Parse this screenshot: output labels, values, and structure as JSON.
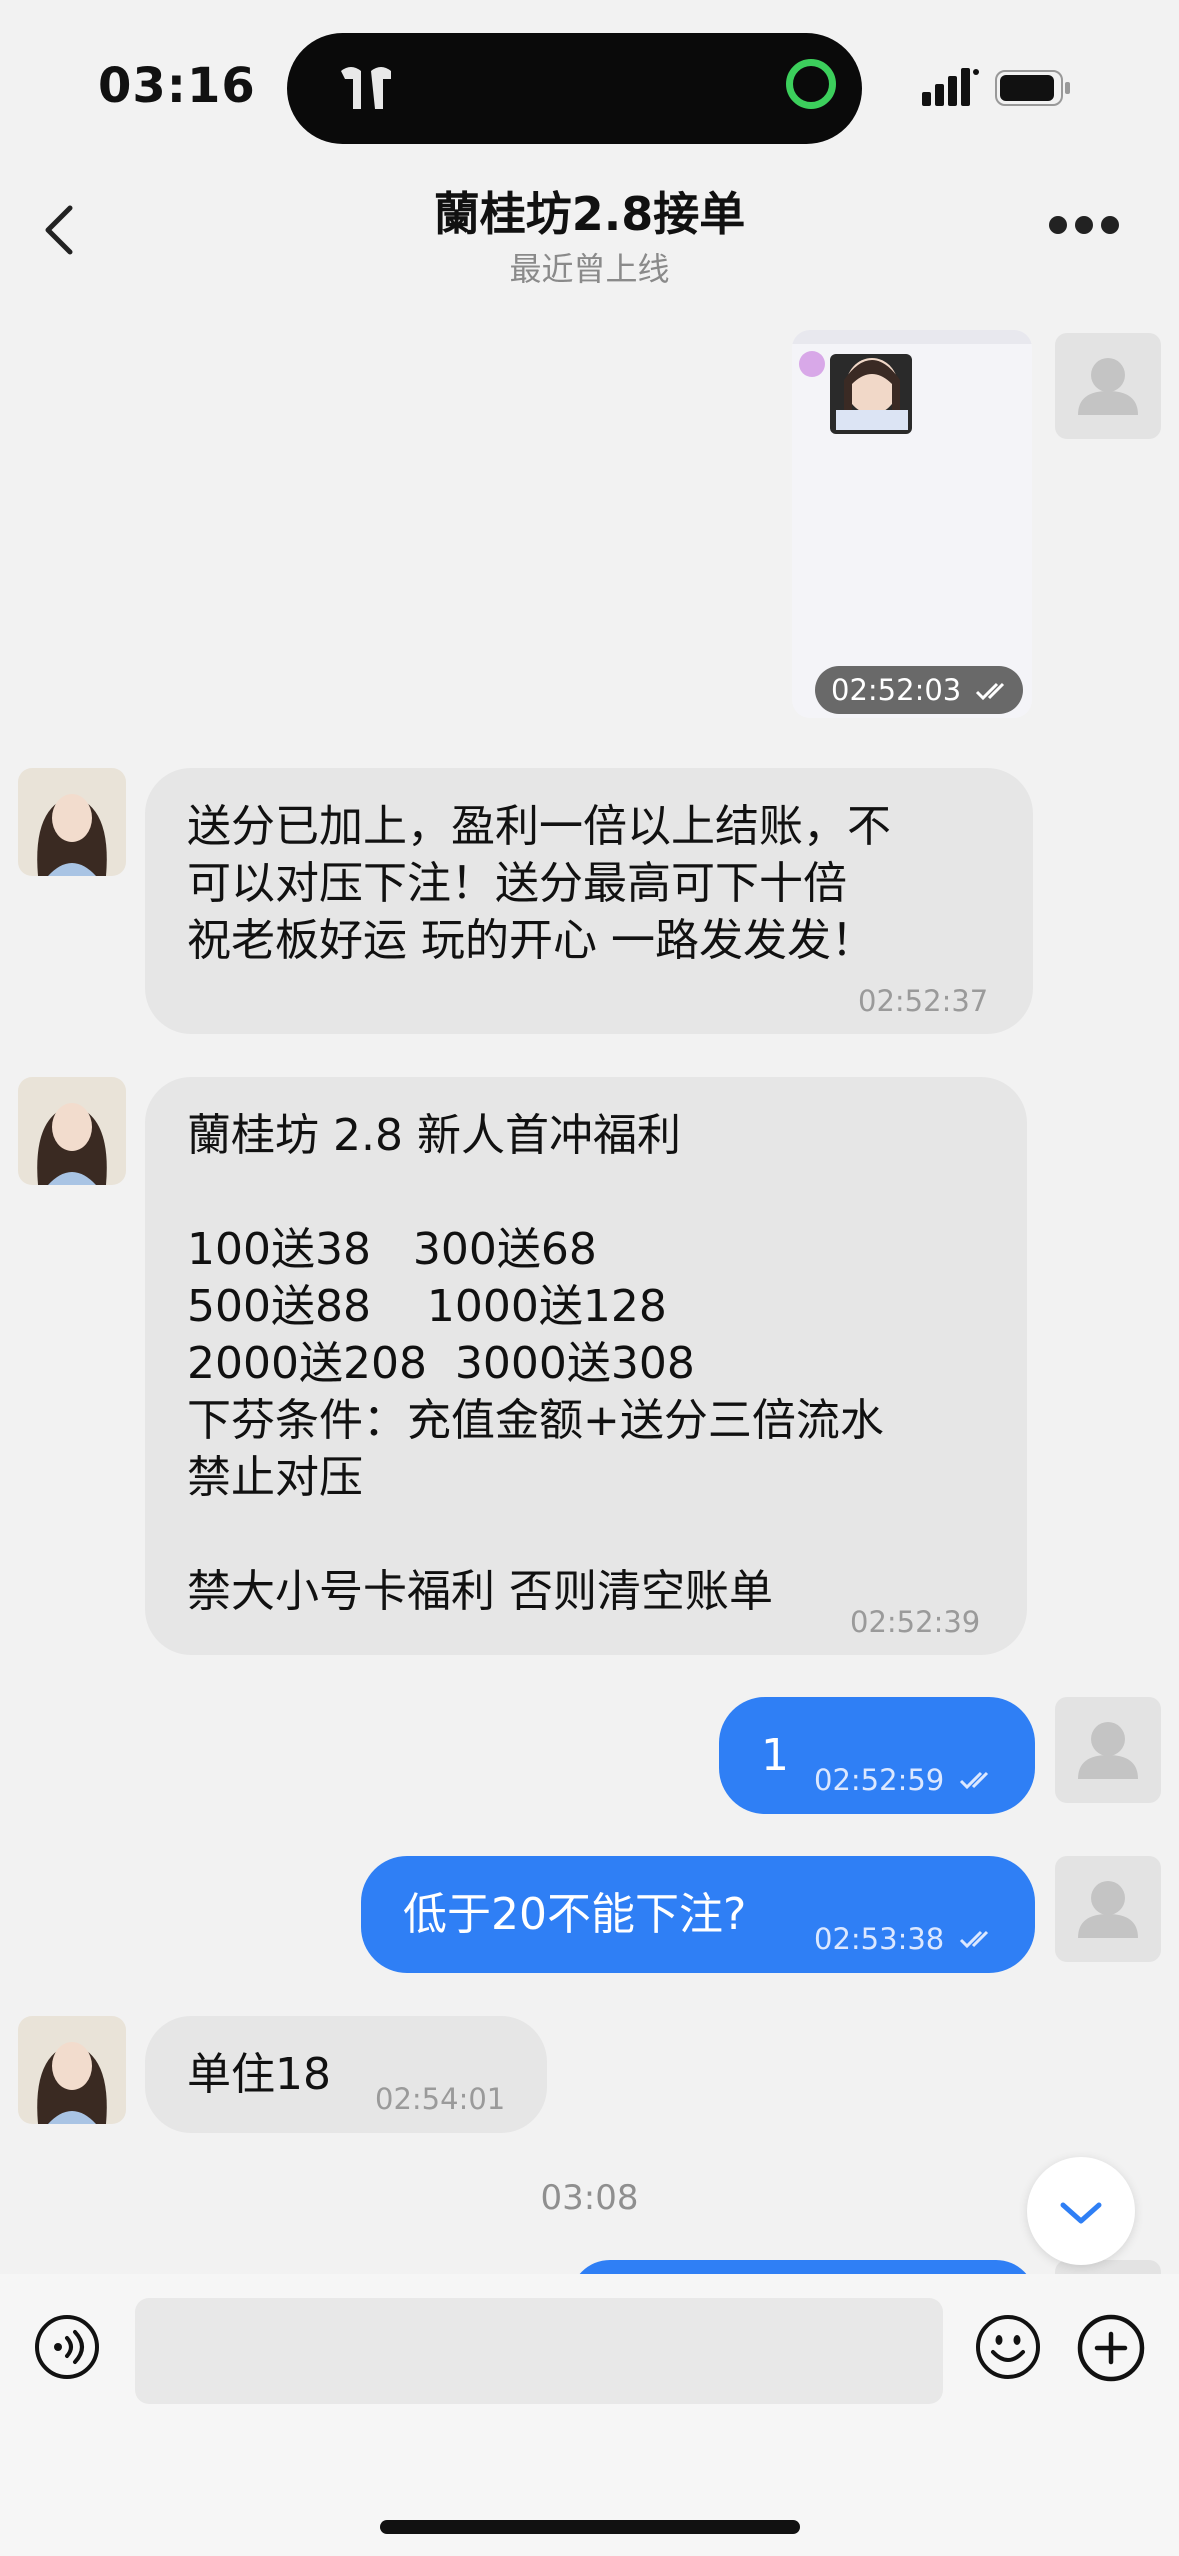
{
  "status": {
    "time": "03:16"
  },
  "header": {
    "title": "蘭桂坊2.8接单",
    "subtitle": "最近曾上线"
  },
  "messages": {
    "image_time": "02:52:03",
    "m1": {
      "text": "送分已加上，盈利一倍以上结账，不\n可以对压下注！送分最高可下十倍\n祝老板好运 玩的开心 一路发发发！",
      "time": "02:52:37"
    },
    "m2": {
      "text": "蘭桂坊 2.8 新人首冲福利\n\n100送38   300送68\n500送88    1000送128\n2000送208  3000送308\n下芬条件：充值金额+送分三倍流水\n禁止对压\n\n禁大小号卡福利 否则清空账单",
      "time": "02:52:39"
    },
    "m3": {
      "text": "1",
      "time": "02:52:59"
    },
    "m4": {
      "text": "低于20不能下注?",
      "time": "02:53:38"
    },
    "m5": {
      "text": "单住18",
      "time": "02:54:01"
    },
    "divider_time": "03:08"
  },
  "colors": {
    "outgoing_bubble": "#2f7ff5",
    "incoming_bubble": "#e6e6e6",
    "background": "#f2f2f2"
  },
  "icons": [
    "back-chevron-icon",
    "more-icon",
    "voice-icon",
    "emoji-icon",
    "plus-icon",
    "scroll-down-icon",
    "read-check-icon"
  ]
}
